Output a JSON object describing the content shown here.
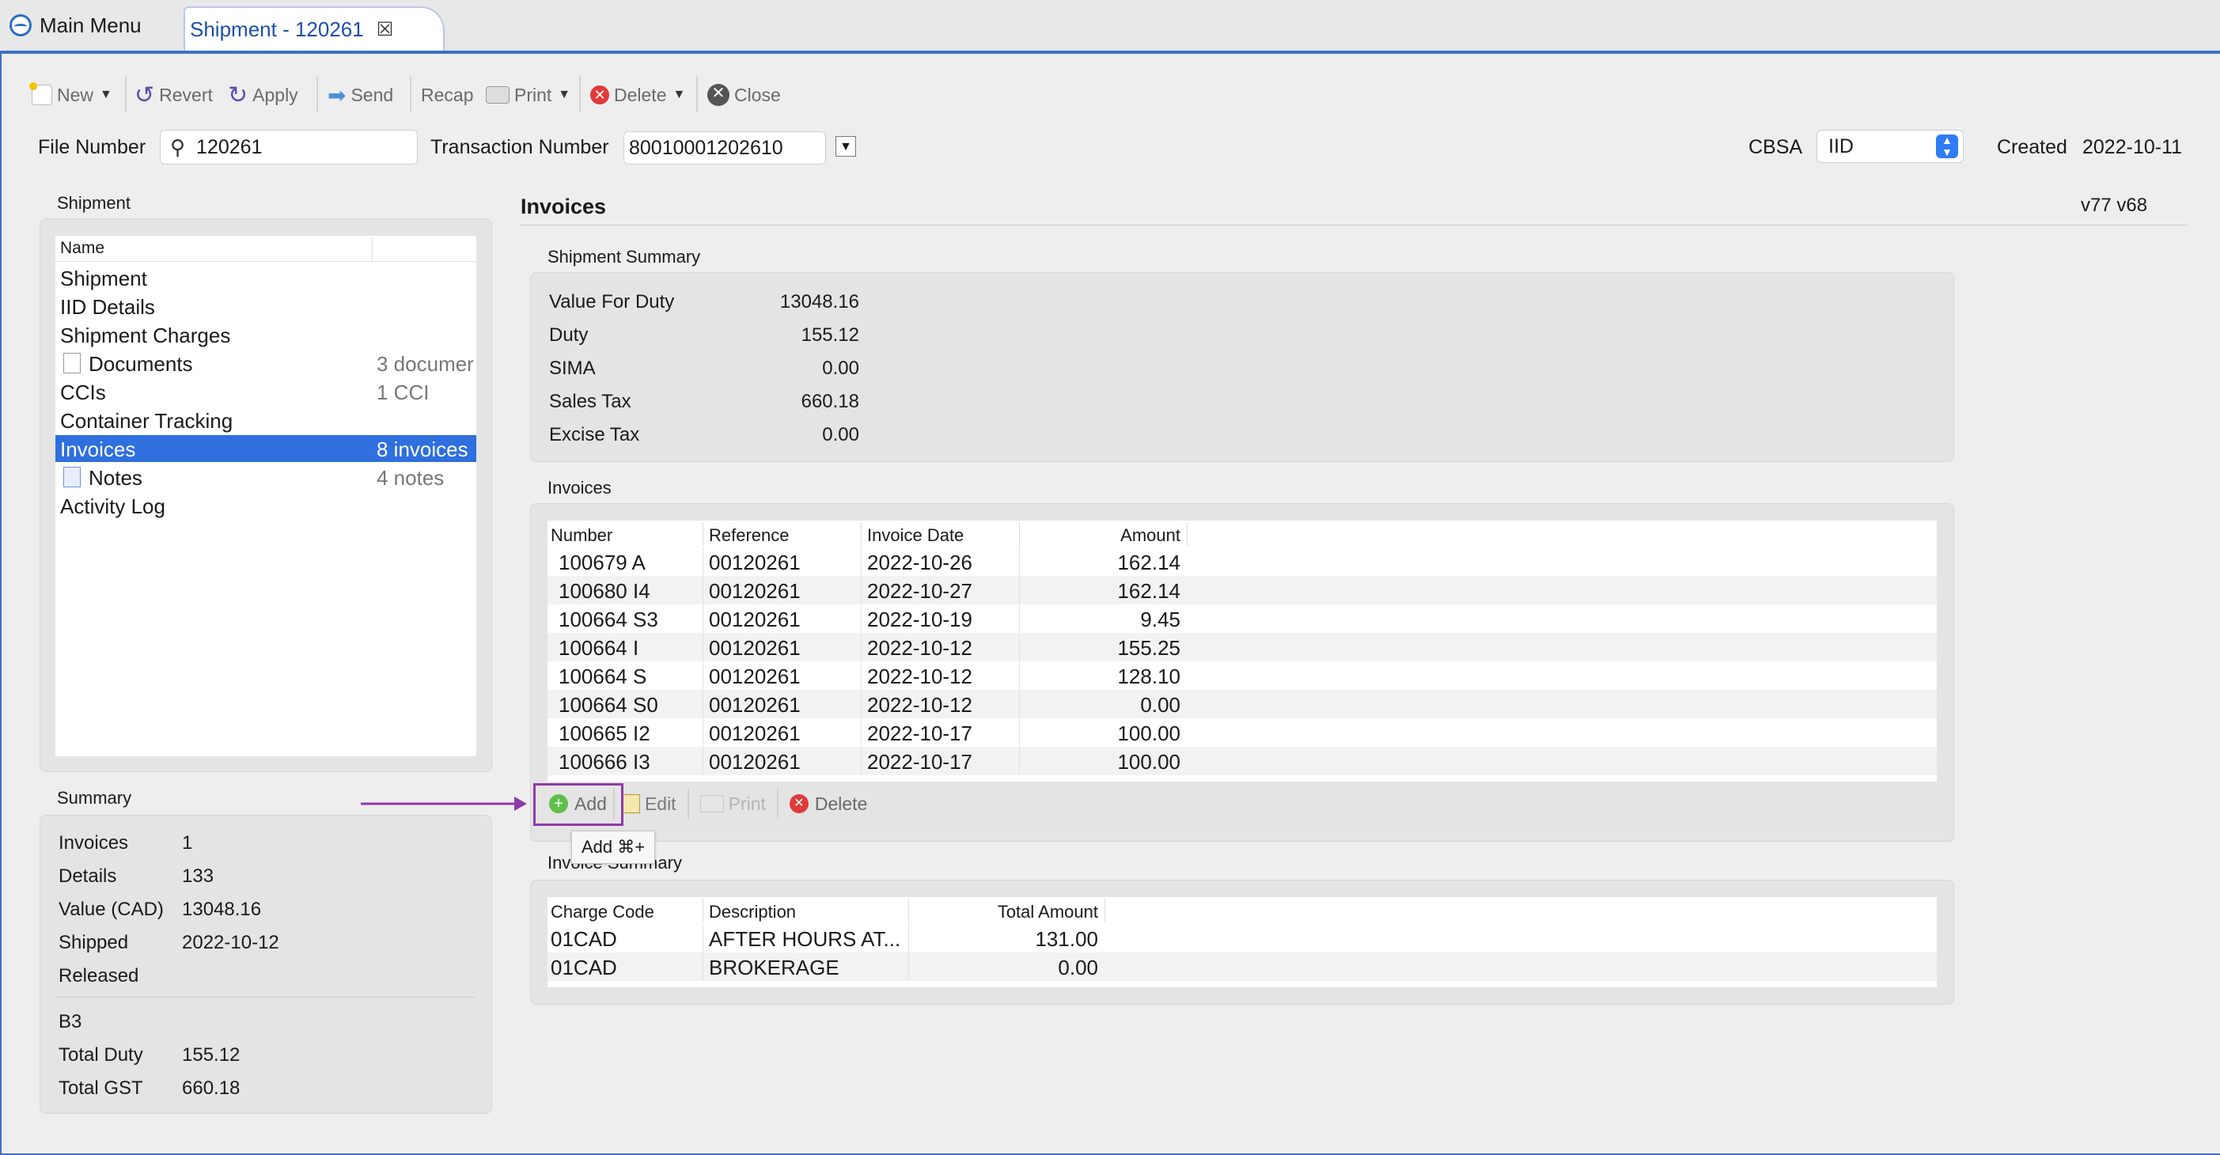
{
  "tabs": {
    "main_menu": "Main Menu",
    "active": "Shipment - 120261",
    "close_glyph": "☒"
  },
  "toolbar": {
    "new": "New",
    "revert": "Revert",
    "apply": "Apply",
    "send": "Send",
    "recap": "Recap",
    "print": "Print",
    "delete": "Delete",
    "close": "Close"
  },
  "header": {
    "file_number_label": "File Number",
    "file_number": "120261",
    "transaction_label": "Transaction Number",
    "transaction_number": "80010001202610",
    "cbsa_label": "CBSA",
    "cbsa_value": "IID",
    "created_label": "Created",
    "created_value": "2022-10-11"
  },
  "nav": {
    "title": "Shipment",
    "header_name": "Name",
    "items": [
      {
        "label": "Shipment",
        "count": ""
      },
      {
        "label": "IID Details",
        "count": ""
      },
      {
        "label": "Shipment Charges",
        "count": ""
      },
      {
        "label": "Documents",
        "count": "3 documer"
      },
      {
        "label": "CCIs",
        "count": "1 CCI"
      },
      {
        "label": "Container Tracking",
        "count": ""
      },
      {
        "label": "Invoices",
        "count": "8 invoices"
      },
      {
        "label": "Notes",
        "count": "4 notes"
      },
      {
        "label": "Activity Log",
        "count": ""
      }
    ]
  },
  "summary": {
    "title": "Summary",
    "rows": [
      {
        "label": "Invoices",
        "value": "1"
      },
      {
        "label": "Details",
        "value": "133"
      },
      {
        "label": "Value (CAD)",
        "value": "13048.16"
      },
      {
        "label": "Shipped",
        "value": "2022-10-12"
      },
      {
        "label": "Released",
        "value": ""
      }
    ],
    "b3_label": "B3",
    "b3_rows": [
      {
        "label": "Total Duty",
        "value": "155.12"
      },
      {
        "label": "Total GST",
        "value": "660.18"
      }
    ]
  },
  "main": {
    "title": "Invoices",
    "version": "v77 v68",
    "shipment_summary": {
      "title": "Shipment Summary",
      "rows": [
        {
          "label": "Value For Duty",
          "value": "13048.16"
        },
        {
          "label": "Duty",
          "value": "155.12"
        },
        {
          "label": "SIMA",
          "value": "0.00"
        },
        {
          "label": "Sales Tax",
          "value": "660.18"
        },
        {
          "label": "Excise Tax",
          "value": "0.00"
        }
      ]
    },
    "invoices": {
      "title": "Invoices",
      "columns": [
        "Number",
        "Reference",
        "Invoice Date",
        "Amount"
      ],
      "rows": [
        [
          "100679 A",
          "00120261",
          "2022-10-26",
          "162.14"
        ],
        [
          "100680 I4",
          "00120261",
          "2022-10-27",
          "162.14"
        ],
        [
          "100664 S3",
          "00120261",
          "2022-10-19",
          "9.45"
        ],
        [
          "100664 I",
          "00120261",
          "2022-10-12",
          "155.25"
        ],
        [
          "100664 S",
          "00120261",
          "2022-10-12",
          "128.10"
        ],
        [
          "100664 S0",
          "00120261",
          "2022-10-12",
          "0.00"
        ],
        [
          "100665 I2",
          "00120261",
          "2022-10-17",
          "100.00"
        ],
        [
          "100666 I3",
          "00120261",
          "2022-10-17",
          "100.00"
        ]
      ],
      "buttons": {
        "add": "Add",
        "edit": "Edit",
        "print": "Print",
        "delete": "Delete"
      },
      "tooltip": "Add ⌘+"
    },
    "invoice_summary": {
      "title": "Invoice Summary",
      "columns": [
        "Charge Code",
        "Description",
        "Total Amount"
      ],
      "rows": [
        [
          "01CAD",
          "AFTER HOURS AT...",
          "131.00"
        ],
        [
          "01CAD",
          "BROKERAGE",
          "0.00"
        ]
      ]
    }
  },
  "colors": {
    "selection": "#2f6fde",
    "accent_border": "#3d6fc9",
    "annotation": "#8e3aa8"
  }
}
